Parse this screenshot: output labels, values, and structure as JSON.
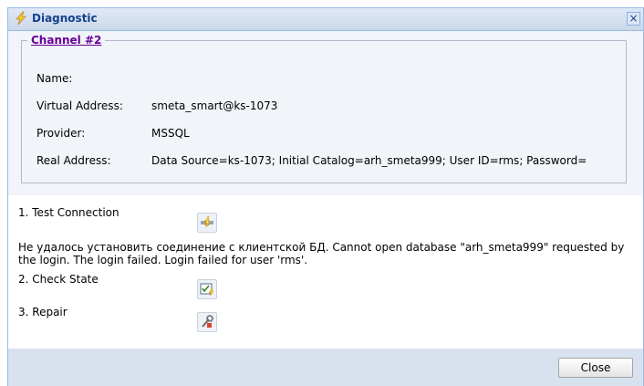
{
  "window": {
    "title": "Diagnostic",
    "close_symbol": "×",
    "title_icon": "lightning-icon"
  },
  "channel": {
    "legend": "Channel #2",
    "fields": [
      {
        "label": "Name:",
        "value": ""
      },
      {
        "label": "Virtual Address:",
        "value": "smeta_smart@ks-1073"
      },
      {
        "label": "Provider:",
        "value": "MSSQL"
      },
      {
        "label": "Real Address:",
        "value": "Data Source=ks-1073; Initial Catalog=arh_smeta999; User ID=rms; Password="
      }
    ]
  },
  "steps": {
    "test_connection": {
      "label": "1. Test Connection",
      "icon": "plug-icon"
    },
    "error_message": "Не удалось установить соединение с клиентской БД. Cannot open database \"arh_smeta999\" requested by the login. The login failed. Login failed for user 'rms'.",
    "check_state": {
      "label": "2. Check State",
      "icon": "check-state-icon"
    },
    "repair": {
      "label": "3. Repair",
      "icon": "repair-icon"
    }
  },
  "footer": {
    "close_label": "Close"
  }
}
